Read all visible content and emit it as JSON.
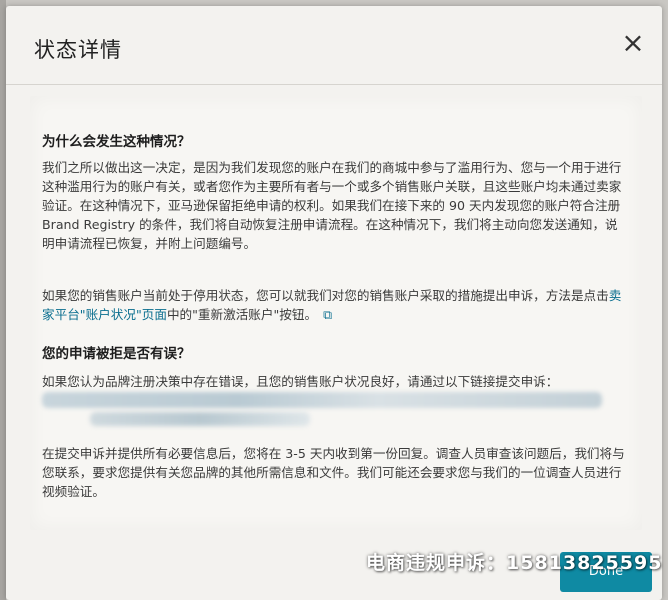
{
  "dialog": {
    "title": "状态详情",
    "close_icon": "×"
  },
  "section1": {
    "title": "为什么会发生这种情况？",
    "para1": "我们之所以做出这一决定，是因为我们发现您的账户在我们的商城中参与了滥用行为、您与一个用于进行这种滥用行为的账户有关，或者您作为主要所有者与一个或多个销售账户关联，且这些账户均未通过卖家验证。在这种情况下，亚马逊保留拒绝申请的权利。如果我们在接下来的 90 天内发现您的账户符合注册 Brand Registry 的条件，我们将自动恢复注册申请流程。在这种情况下，我们将主动向您发送通知，说明申请流程已恢复，并附上问题编号。",
    "para2_prefix": "如果您的销售账户当前处于停用状态，您可以就我们对您的销售账户采取的措施提出申诉，方法是点击",
    "para2_link": "卖家平台\"账户状况\"页面",
    "para2_suffix": "中的\"重新激活账户\"按钮。",
    "external_link_icon": "⧉"
  },
  "section2": {
    "title": "您的申请被拒是否有误？",
    "para1": "如果您认为品牌注册决策中存在错误，且您的销售账户状况良好，请通过以下链接提交申诉：",
    "para2": "在提交申诉并提供所有必要信息后，您将在 3-5 天内收到第一份回复。调查人员审查该问题后，我们将与您联系，要求您提供有关您品牌的其他所需信息和文件。我们可能还会要求您与我们的一位调查人员进行视频验证。"
  },
  "footer": {
    "done_label": "Done"
  },
  "watermark": {
    "text": "电商违规申诉：15813825595"
  }
}
